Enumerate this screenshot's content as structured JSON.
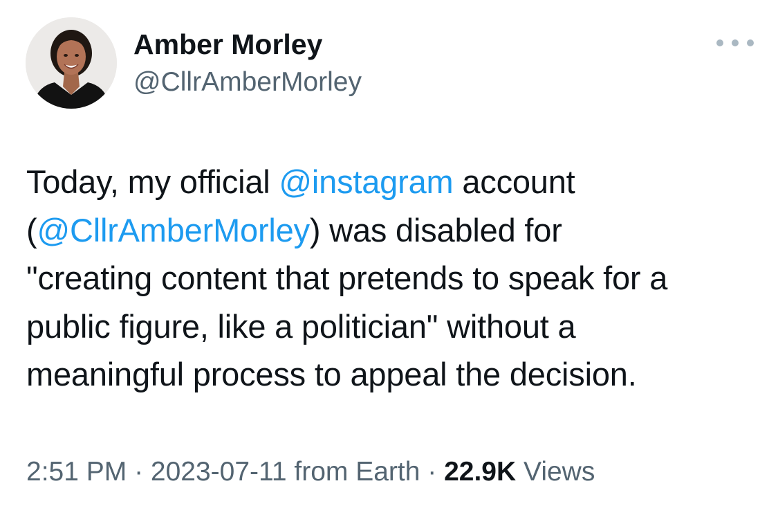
{
  "author": {
    "name": "Amber Morley",
    "handle": "@CllrAmberMorley"
  },
  "tweet": {
    "line1": {
      "before": "Today, my official ",
      "mention": "@instagram",
      "after": " account"
    },
    "line2": {
      "before": "(",
      "mention": "@CllrAmberMorley",
      "after": ") was disabled for"
    },
    "line3": "\"creating content that pretends to speak for a",
    "line4": "public figure, like a politician\" without a",
    "line5": "meaningful process to appeal the decision."
  },
  "meta": {
    "time": "2:51 PM",
    "sep1": " · ",
    "date": "2023-07-11",
    "source": " from Earth",
    "sep2": " · ",
    "views_count": "22.9K",
    "views_label": " Views"
  },
  "icons": {
    "more": "more-horizontal-icon",
    "avatar": "avatar-photo"
  },
  "colors": {
    "text": "#0f1419",
    "secondary": "#536471",
    "link": "#1d9bf0",
    "more_dots": "#aab8c2"
  }
}
